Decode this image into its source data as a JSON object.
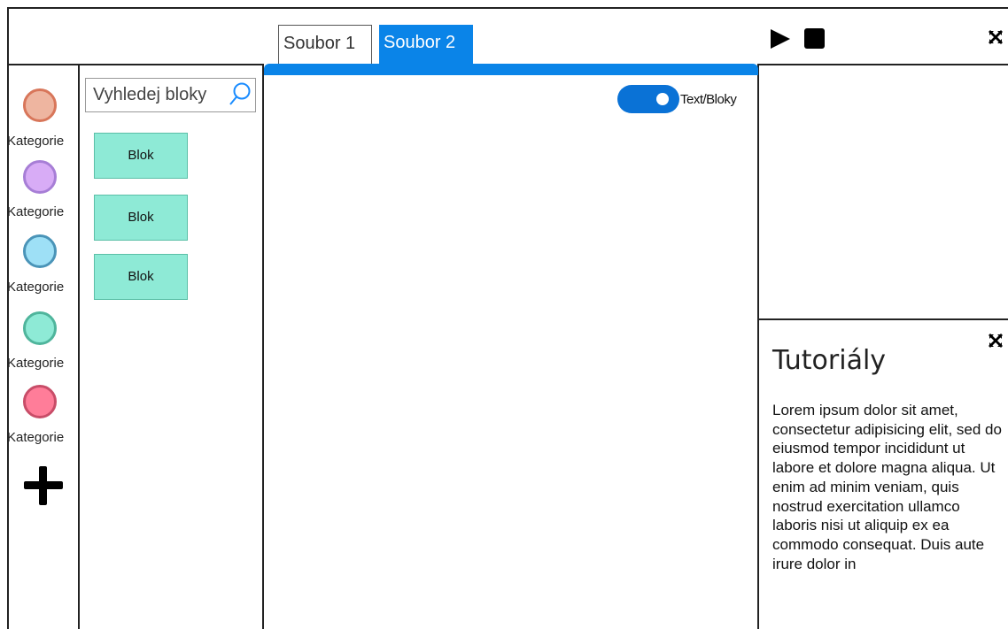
{
  "tabs": [
    {
      "label": "Soubor 1",
      "active": false
    },
    {
      "label": "Soubor 2",
      "active": true
    }
  ],
  "toolbar": {
    "play_icon": "play-icon",
    "stop_icon": "stop-icon",
    "expand_icon": "expand-icon"
  },
  "categories": [
    {
      "label": "Kategorie",
      "fill": "#eeb5a0",
      "border": "#d8765a"
    },
    {
      "label": "Kategorie",
      "fill": "#d8acf6",
      "border": "#a77ed6"
    },
    {
      "label": "Kategorie",
      "fill": "#9ee0f6",
      "border": "#4a94b8"
    },
    {
      "label": "Kategorie",
      "fill": "#8eead6",
      "border": "#4fb59c"
    },
    {
      "label": "Kategorie",
      "fill": "#ff7d99",
      "border": "#c84d68"
    }
  ],
  "add_category_icon": "plus-icon",
  "search": {
    "placeholder": "Vyhledej bloky",
    "icon": "search-icon"
  },
  "blocks": [
    "Blok",
    "Blok",
    "Blok"
  ],
  "editor": {
    "toggle_label": "Text/Bloky",
    "toggle_on": true
  },
  "tutorials": {
    "title": "Tutoriály",
    "text": "Lorem ipsum dolor sit amet, consectetur adipisicing elit, sed do eiusmod tempor incididunt ut labore et dolore magna aliqua. Ut enim ad minim veniam, quis nostrud exercitation ullamco laboris nisi ut aliquip ex ea commodo consequat. Duis aute irure dolor in"
  },
  "colors": {
    "accent": "#0a84e8",
    "block_fill": "#8eead6"
  }
}
